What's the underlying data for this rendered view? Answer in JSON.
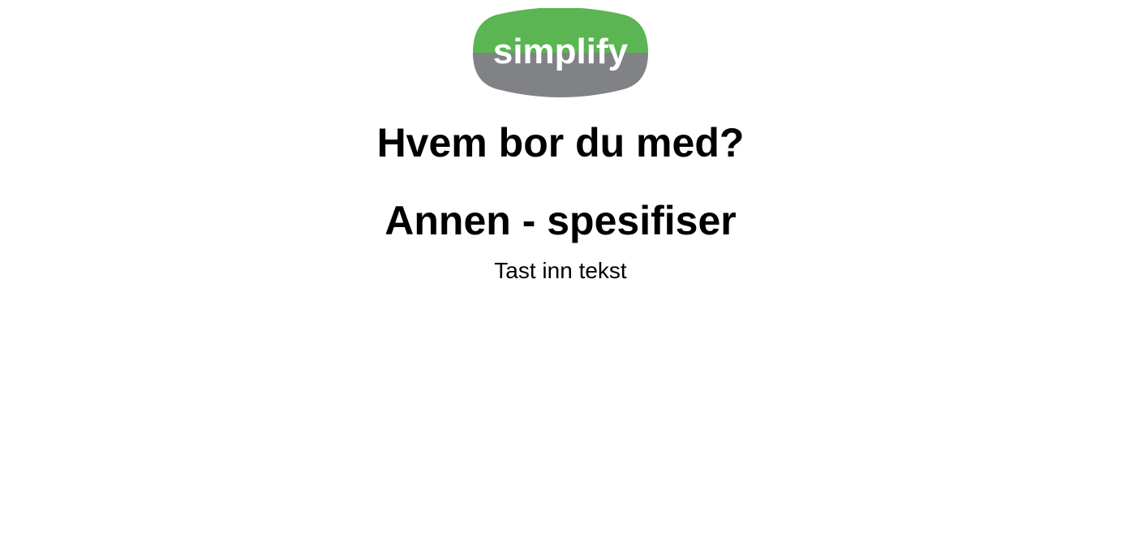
{
  "logo": {
    "text": "simplify",
    "top_color": "#5ab552",
    "bottom_color": "#818286",
    "text_color": "#ffffff"
  },
  "question": {
    "title": "Hvem bor du med?"
  },
  "option": {
    "title": "Annen - spesifiser"
  },
  "input": {
    "value": "",
    "placeholder": "Tast inn tekst"
  }
}
